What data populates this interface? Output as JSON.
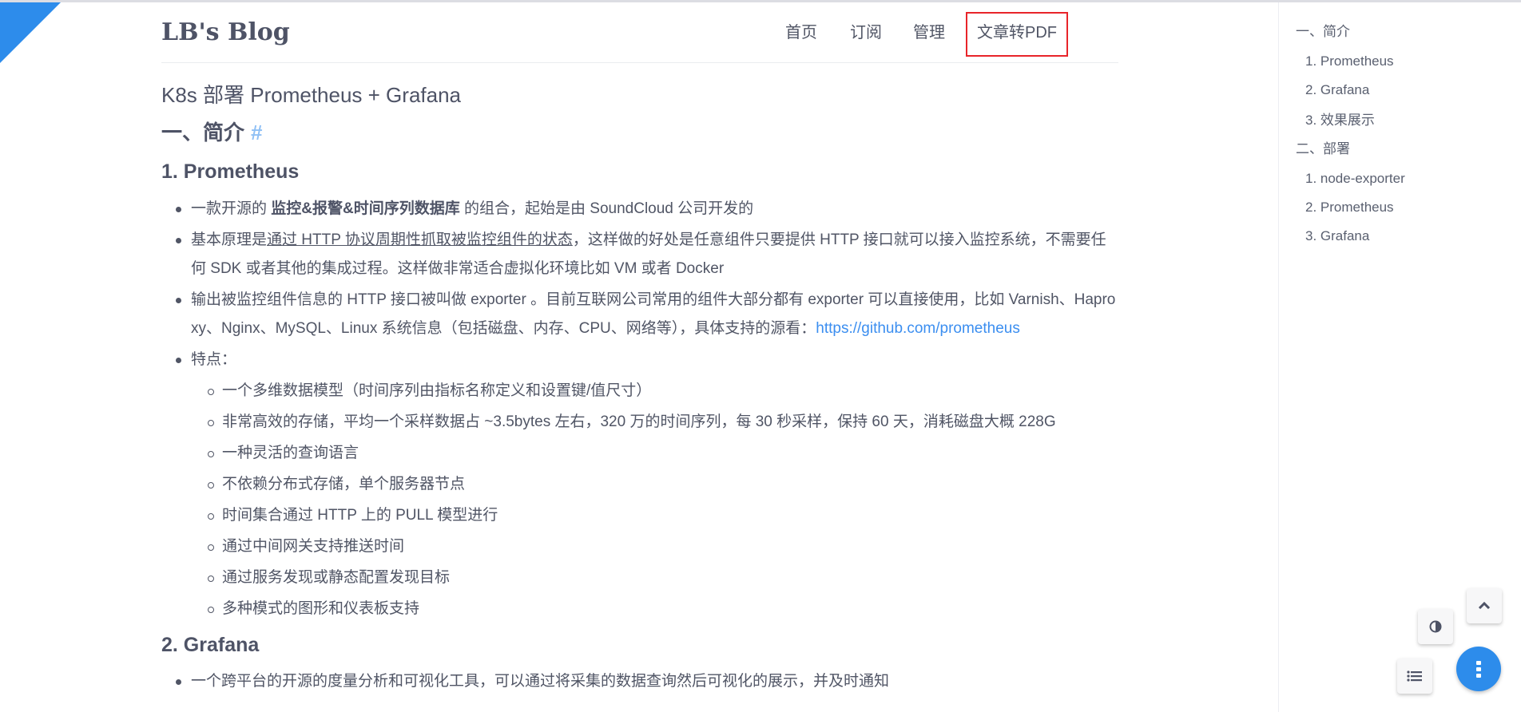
{
  "header": {
    "logo": "LB's Blog",
    "nav": [
      "首页",
      "订阅",
      "管理",
      "文章转PDF"
    ]
  },
  "article": {
    "title": "K8s 部署 Prometheus + Grafana",
    "h2_intro": "一、简介",
    "anchor": "#",
    "h3_prometheus": "1. Prometheus",
    "li1": {
      "a": "一款开源的 ",
      "bold": "监控&报警&时间序列数据库",
      "b": " 的组合，起始是由 SoundCloud 公司开发的"
    },
    "li2": {
      "a": "基本原理是",
      "underline": "通过 HTTP 协议周期性抓取被监控组件的状态",
      "b": "，这样做的好处是任意组件只要提供 HTTP 接口就可以接入监控系统，不需要任何 SDK 或者其他的集成过程。这样做非常适合虚拟化环境比如 VM 或者 Docker"
    },
    "li3": {
      "a": "输出被监控组件信息的 HTTP 接口被叫做 exporter 。目前互联网公司常用的组件大部分都有 exporter 可以直接使用，比如 Varnish、Haproxy、Nginx、MySQL、Linux 系统信息（包括磁盘、内存、CPU、网络等），具体支持的源看：",
      "link": "https://github.com/prometheus"
    },
    "li4": "特点：",
    "features": [
      "一个多维数据模型（时间序列由指标名称定义和设置键/值尺寸）",
      "非常高效的存储，平均一个采样数据占 ~3.5bytes 左右，320 万的时间序列，每 30 秒采样，保持 60 天，消耗磁盘大概 228G",
      "一种灵活的查询语言",
      "不依赖分布式存储，单个服务器节点",
      "时间集合通过 HTTP 上的 PULL 模型进行",
      "通过中间网关支持推送时间",
      "通过服务发现或静态配置发现目标",
      "多种模式的图形和仪表板支持"
    ],
    "h3_grafana": "2. Grafana",
    "grafana_li1": "一个跨平台的开源的度量分析和可视化工具，可以通过将采集的数据查询然后可视化的展示，并及时通知"
  },
  "toc": [
    "一、简介",
    "1. Prometheus",
    "2. Grafana",
    "3. 效果展示",
    "二、部署",
    "1. node-exporter",
    "2. Prometheus",
    "3. Grafana"
  ],
  "colors": {
    "accent": "#2d8ceb",
    "highlight_border": "#e8242a"
  }
}
